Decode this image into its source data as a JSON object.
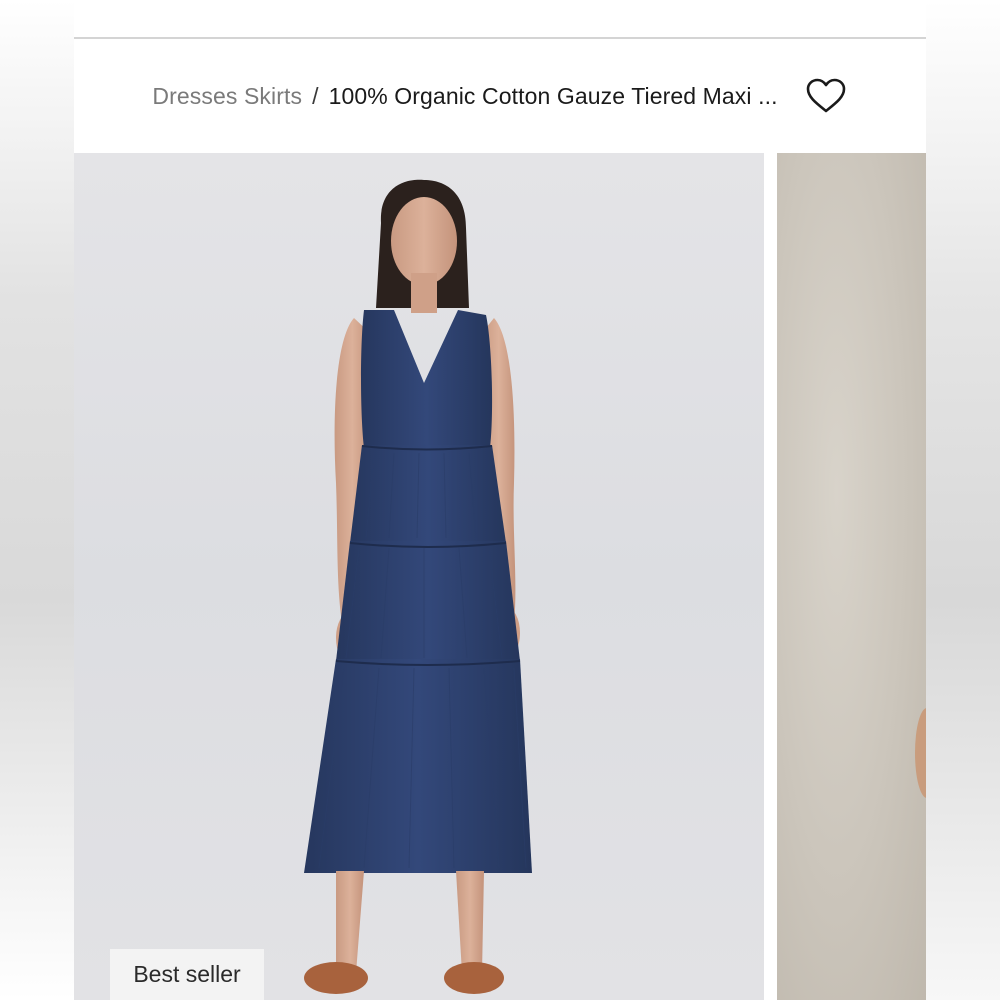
{
  "breadcrumb": {
    "category": "Dresses Skirts",
    "separator": "/",
    "current": "100% Organic Cotton Gauze Tiered Maxi ..."
  },
  "actions": {
    "favorite_icon": "heart-outline-icon"
  },
  "gallery": {
    "badge": "Best seller",
    "slides": [
      {
        "subject": "model-in-navy-tiered-maxi-dress"
      },
      {
        "subject": "next-product-image-peek"
      }
    ]
  },
  "colors": {
    "dress": "#2f4370",
    "background": "#e2e2e5",
    "text_primary": "#1a1a1a",
    "text_muted": "#7a7a7a"
  }
}
